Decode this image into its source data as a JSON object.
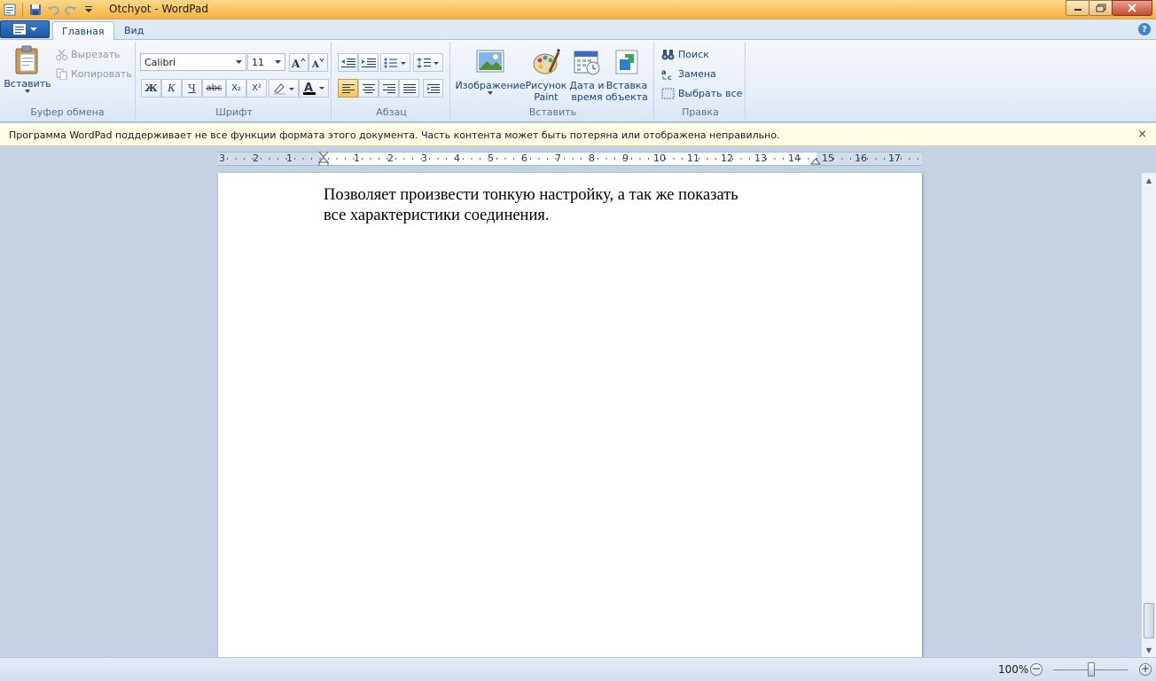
{
  "window": {
    "title": "Otchyot - WordPad"
  },
  "tabs": [
    {
      "label": "Главная",
      "active": true
    },
    {
      "label": "Вид",
      "active": false
    }
  ],
  "ribbon": {
    "clipboard": {
      "paste_label": "Вставить",
      "cut_label": "Вырезать",
      "copy_label": "Копировать",
      "group_label": "Буфер обмена"
    },
    "font": {
      "family": "Calibri",
      "size": "11",
      "bold": "Ж",
      "italic": "К",
      "underline": "Ч",
      "strikethrough": "abc",
      "subscript": "X₂",
      "superscript": "X²",
      "group_label": "Шрифт"
    },
    "paragraph": {
      "group_label": "Абзац"
    },
    "insert": {
      "picture_label": "Изображение",
      "paint_line1": "Рисунок",
      "paint_line2": "Paint",
      "datetime_line1": "Дата и",
      "datetime_line2": "время",
      "object_line1": "Вставка",
      "object_line2": "объекта",
      "group_label": "Вставить"
    },
    "editing": {
      "find_label": "Поиск",
      "replace_label": "Замена",
      "select_all_label": "Выбрать все",
      "group_label": "Правка"
    }
  },
  "infobar": {
    "message": "Программа WordPad поддерживает не все функции формата этого документа. Часть контента может быть потеряна или отображена неправильно.",
    "close": "×"
  },
  "ruler": {
    "labels": [
      "3",
      "2",
      "1",
      "1",
      "2",
      "3",
      "4",
      "5",
      "6",
      "7",
      "8",
      "9",
      "10",
      "11",
      "12",
      "13",
      "14",
      "15",
      "16",
      "17"
    ]
  },
  "document": {
    "line1": "Позволяет произвести тонкую настройку, а так же показать",
    "line2": "все характеристики соединения."
  },
  "status": {
    "zoom": "100%",
    "zoom_out": "−",
    "zoom_in": "+"
  },
  "colors": {
    "accent": "#f7c15c",
    "ribbon": "#dae5f3",
    "infobar": "#fefde3",
    "page": "#ffffff",
    "workspace": "#c5d2e3"
  }
}
